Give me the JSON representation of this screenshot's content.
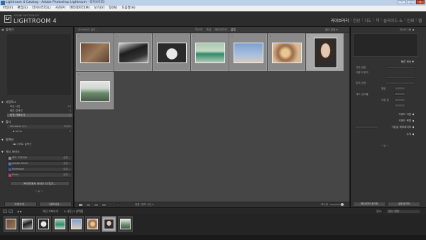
{
  "window": {
    "title": "Lightroom 4 Catalog - Adobe Photoshop Lightroom - 라이브러리",
    "controls": [
      "─",
      "□",
      "✕"
    ]
  },
  "menu": [
    "파일(F)",
    "편집(E)",
    "라이브러리(L)",
    "사진(P)",
    "메타데이터(M)",
    "보기(V)",
    "창(W)",
    "도움말(H)"
  ],
  "identity": {
    "logo": "Lr",
    "brand_small": "ADOBE PHOTOSHOP",
    "brand_big": "LIGHTROOM 4"
  },
  "modules": {
    "items": [
      "라이브러리",
      "현상",
      "지도",
      "책",
      "슬라이드 쇼",
      "인쇄",
      "웹"
    ],
    "active_index": 0
  },
  "left_panel": {
    "navigator": "탐색기",
    "catalog": {
      "header": "카탈로그",
      "rows": [
        {
          "label": "모든 사진",
          "count": "43"
        },
        {
          "label": "빠른 컬렉션",
          "count": "0"
        },
        {
          "label": "이전 가져오기",
          "count": "9"
        }
      ],
      "selected_index": 2
    },
    "folders": {
      "header": "폴더",
      "volume": {
        "label": "Windows (C:)",
        "count": "50/89"
      },
      "rows": [
        {
          "label": "temp",
          "count": "9"
        }
      ]
    },
    "collections": {
      "header": "컬렉션",
      "rows": [
        {
          "label": "스마트 컬렉션",
          "count": ""
        }
      ]
    },
    "publish": {
      "header": "게시 서비스",
      "rows": [
        {
          "label": "하드 드라이브",
          "count": "설정...",
          "icon": "hard-drive-icon",
          "color": "#8a8a8a"
        },
        {
          "label": "Adobe Revel",
          "count": "설정...",
          "icon": "revel-icon",
          "color": "#4a74c8"
        },
        {
          "label": "Facebook",
          "count": "설정...",
          "icon": "facebook-icon",
          "color": "#3b5998"
        },
        {
          "label": "Flickr",
          "count": "설정...",
          "icon": "flickr-icon",
          "color": "#d1347a"
        }
      ],
      "more_button": "온라인에서 서비스 더 찾기..."
    },
    "import_button": "가져오기...",
    "export_button": "내보내기..."
  },
  "center": {
    "breadcrumb": "라이브러리 필터 :",
    "filters": [
      "텍스트",
      "특성",
      "메타데이터",
      "없음"
    ],
    "active_filter_index": 3,
    "filter_lock": "필터 해제 ▾",
    "grid": [
      {
        "num": "1",
        "colors": [
          "#6b4a35",
          "#9a7a5a"
        ],
        "selected": false
      },
      {
        "num": "2",
        "colors": [
          "#1e1e1e",
          "#cfcfcf"
        ],
        "selected": false
      },
      {
        "num": "3",
        "colors": [
          "#2a2a2a",
          "#e9e9e9"
        ],
        "selected": false
      },
      {
        "num": "4",
        "colors": [
          "#2e8c6a",
          "#a8c8b0"
        ],
        "selected": false
      },
      {
        "num": "5",
        "colors": [
          "#7ea0cf",
          "#d9c9b9"
        ],
        "selected": false
      },
      {
        "num": "6",
        "colors": [
          "#9a6a4a",
          "#d8b890"
        ],
        "selected": false
      },
      {
        "num": "7",
        "colors": [
          "#e4c9b0",
          "#2c2c2c"
        ],
        "selected": true
      },
      {
        "num": "8",
        "colors": [
          "#6a8a6a",
          "#e4e4e4"
        ],
        "selected": false
      }
    ]
  },
  "toolbar": {
    "sort_label": "정렬: 캡처 시간 ▾",
    "thumb_label": "축소판"
  },
  "right_panel": {
    "histogram": "히스토그램",
    "quick_develop": "빠른 현상",
    "qd_rows": [
      "사전 설정",
      "흰색 균형",
      "색조 컨트롤"
    ],
    "qd_values": [
      "사용자 정의",
      "원본",
      "자동 톤"
    ],
    "keywording": "키워드 지정",
    "keyword_list": "키워드 목록",
    "metadata": "메타데이터",
    "metadata_preset": "기본값",
    "comments": "주석",
    "sync_buttons": [
      "메타데이터 동기화",
      "설정 동기화"
    ]
  },
  "filmstrip": {
    "source": "이전 가져오기",
    "count_label": "9 사진 /1 선택됨",
    "filter_label": "필터:",
    "filter_value": "필터 해제",
    "thumbs": [
      "#6b4a35",
      "#2a2a2a",
      "#e9e9e9",
      "#2e8c6a",
      "#7ea0cf",
      "#9a6a4a",
      "#e4c9b0",
      "#6a8a6a"
    ],
    "selected_index": 6
  }
}
